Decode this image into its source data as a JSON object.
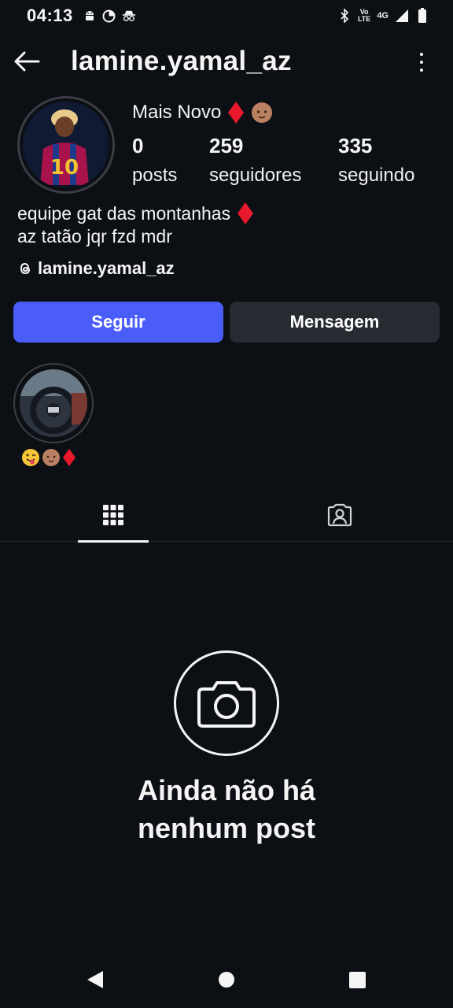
{
  "status_bar": {
    "time": "04:13",
    "left_icons": [
      "android-icon",
      "data-saver-icon",
      "incognito-icon"
    ],
    "right_icons": [
      "bluetooth-icon",
      "volte-icon",
      "signal-4g-icon",
      "signal-icon",
      "battery-icon"
    ],
    "volte_top": "Vo",
    "volte_bottom": "LTE",
    "network": "4G"
  },
  "header": {
    "username": "lamine.yamal_az"
  },
  "profile": {
    "name": "Mais Novo",
    "name_emojis": [
      "red-diamond",
      "baby-medium-skin"
    ],
    "stats": [
      {
        "value": "0",
        "label": "posts"
      },
      {
        "value": "259",
        "label": "seguidores"
      },
      {
        "value": "335",
        "label": "seguindo"
      }
    ],
    "bio_line_1": "equipe gat das montanhas",
    "bio_line_2": "az tatão jqr fzd mdr",
    "threads_handle": "lamine.yamal_az"
  },
  "actions": {
    "follow_label": "Seguir",
    "message_label": "Mensagem"
  },
  "highlights": [
    {
      "label_emojis": [
        "winking-tongue-face",
        "baby-medium-skin",
        "red-diamond"
      ]
    }
  ],
  "tabs": {
    "active": "grid",
    "items": [
      "grid-icon",
      "tagged-icon"
    ]
  },
  "empty_state": {
    "title_line_1": "Ainda não há",
    "title_line_2": "nenhum post"
  },
  "colors": {
    "background": "#0c0f14",
    "follow_button": "#4a5df9",
    "message_button": "#262a31",
    "diamond": "#e8192c"
  }
}
